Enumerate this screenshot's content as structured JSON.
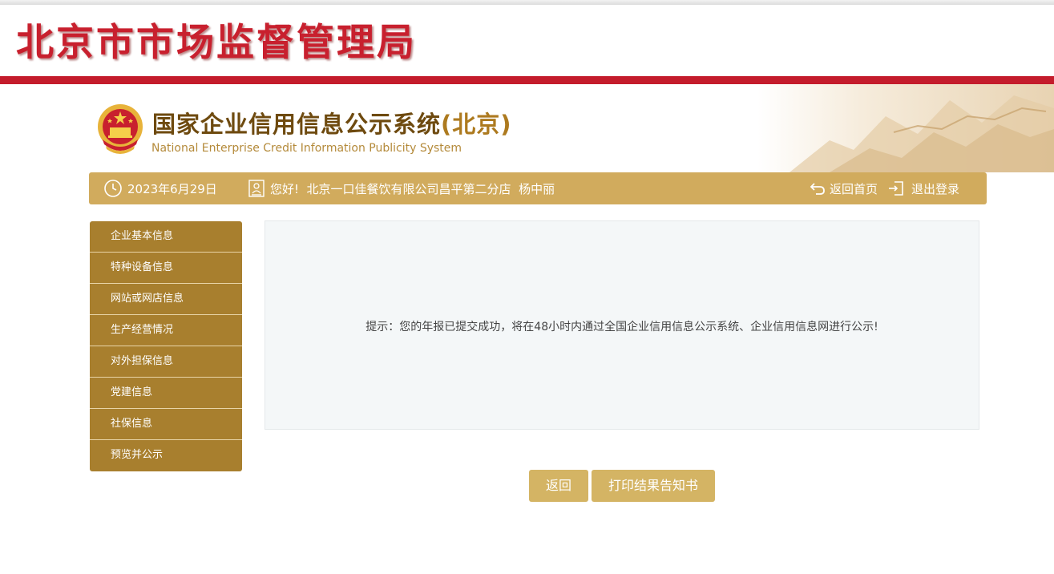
{
  "agency": {
    "title": "北京市市场监督管理局"
  },
  "system": {
    "title": "国家企业信用信息公示系统",
    "region": "(北京)",
    "subtitle": "National Enterprise Credit Information Publicity System"
  },
  "info_bar": {
    "date": "2023年6月29日",
    "greeting": "您好!  北京一口佳餐饮有限公司昌平第二分店  杨中丽",
    "home_label": "返回首页",
    "logout_label": "退出登录"
  },
  "sidebar": {
    "items": [
      {
        "label": "企业基本信息"
      },
      {
        "label": "特种设备信息"
      },
      {
        "label": "网站或网店信息"
      },
      {
        "label": "生产经营情况"
      },
      {
        "label": "对外担保信息"
      },
      {
        "label": "党建信息"
      },
      {
        "label": "社保信息"
      },
      {
        "label": "预览并公示"
      }
    ]
  },
  "content": {
    "notice": "提示：您的年报已提交成功，将在48小时内通过全国企业信用信息公示系统、企业信用信息网进行公示!"
  },
  "actions": {
    "back_label": "返回",
    "print_label": "打印结果告知书"
  }
}
